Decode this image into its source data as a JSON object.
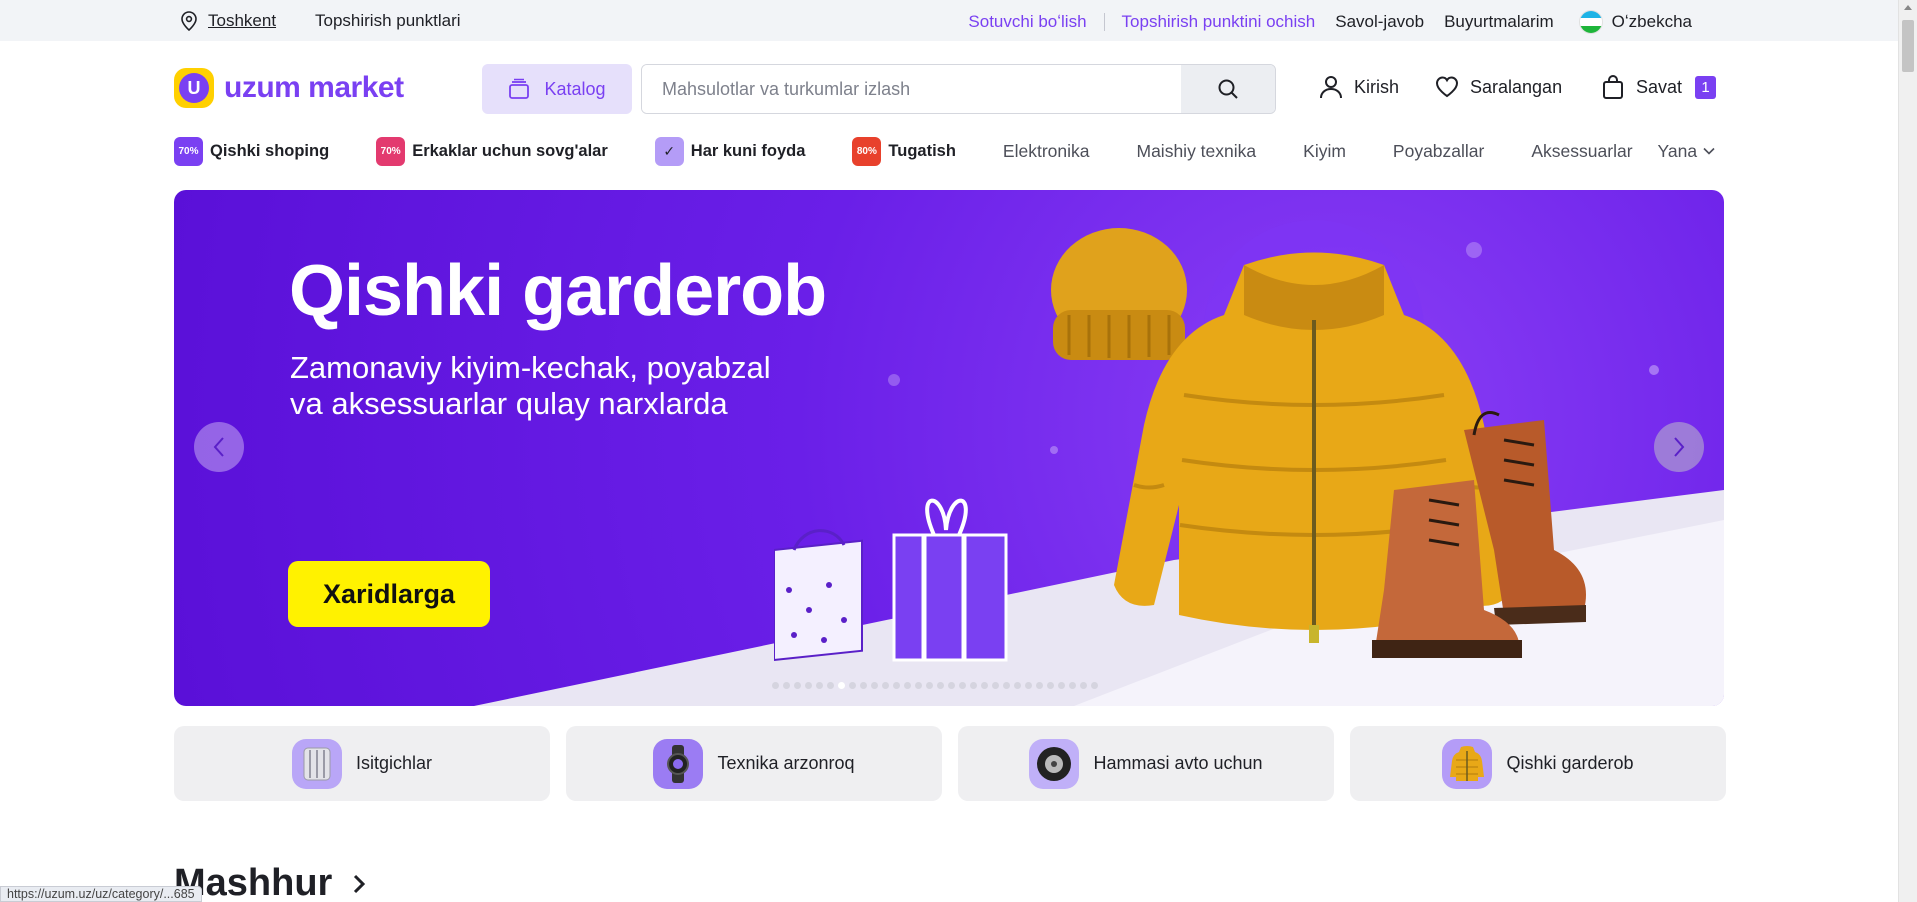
{
  "topbar": {
    "city": "Toshkent",
    "pickup_points": "Topshirish punktlari",
    "seller": "Sotuvchi boʻlish",
    "open_pickup": "Topshirish punktini ochish",
    "faq": "Savol-javob",
    "orders": "Buyurtmalarim",
    "language": "Oʻzbekcha"
  },
  "header": {
    "logo_text": "uzum market",
    "catalog_label": "Katalog",
    "search_placeholder": "Mahsulotlar va turkumlar izlash",
    "login_label": "Kirish",
    "favorites_label": "Saralangan",
    "cart_label": "Savat",
    "cart_count": "1"
  },
  "catnav": {
    "promo_items": [
      {
        "label": "Qishki shoping",
        "badge": "70%",
        "color": "#7a40f2"
      },
      {
        "label": "Erkaklar uchun sovg'alar",
        "badge": "70%",
        "color": "#e33a6f"
      },
      {
        "label": "Har kuni foyda",
        "badge": "✓",
        "color": "#9d7cf5"
      },
      {
        "label": "Tugatish",
        "badge": "80%",
        "color": "#e8412c"
      }
    ],
    "plain_items": [
      "Elektronika",
      "Maishiy texnika",
      "Kiyim",
      "Poyabzallar",
      "Aksessuarlar"
    ],
    "more_label": "Yana"
  },
  "banner": {
    "title": "Qishki garderob",
    "subtitle_line1": "Zamonaviy kiyim-kechak, poyabzal",
    "subtitle_line2": "va aksessuarlar qulay narxlarda",
    "cta": "Xaridlarga",
    "slide_count": 30,
    "active_slide": 6
  },
  "chips": [
    {
      "label": "Isitgichlar",
      "icon": "heater-icon"
    },
    {
      "label": "Texnika arzonroq",
      "icon": "smartwatch-icon"
    },
    {
      "label": "Hammasi avto uchun",
      "icon": "tire-icon"
    },
    {
      "label": "Qishki garderob",
      "icon": "jacket-icon"
    }
  ],
  "section": {
    "title": "Mashhur"
  },
  "statusbar": {
    "url": "https://uzum.uz/uz/category/...685"
  },
  "colors": {
    "brand": "#7a40f2",
    "accent_yellow": "#fff200",
    "topbar_bg": "#f2f4f7"
  }
}
